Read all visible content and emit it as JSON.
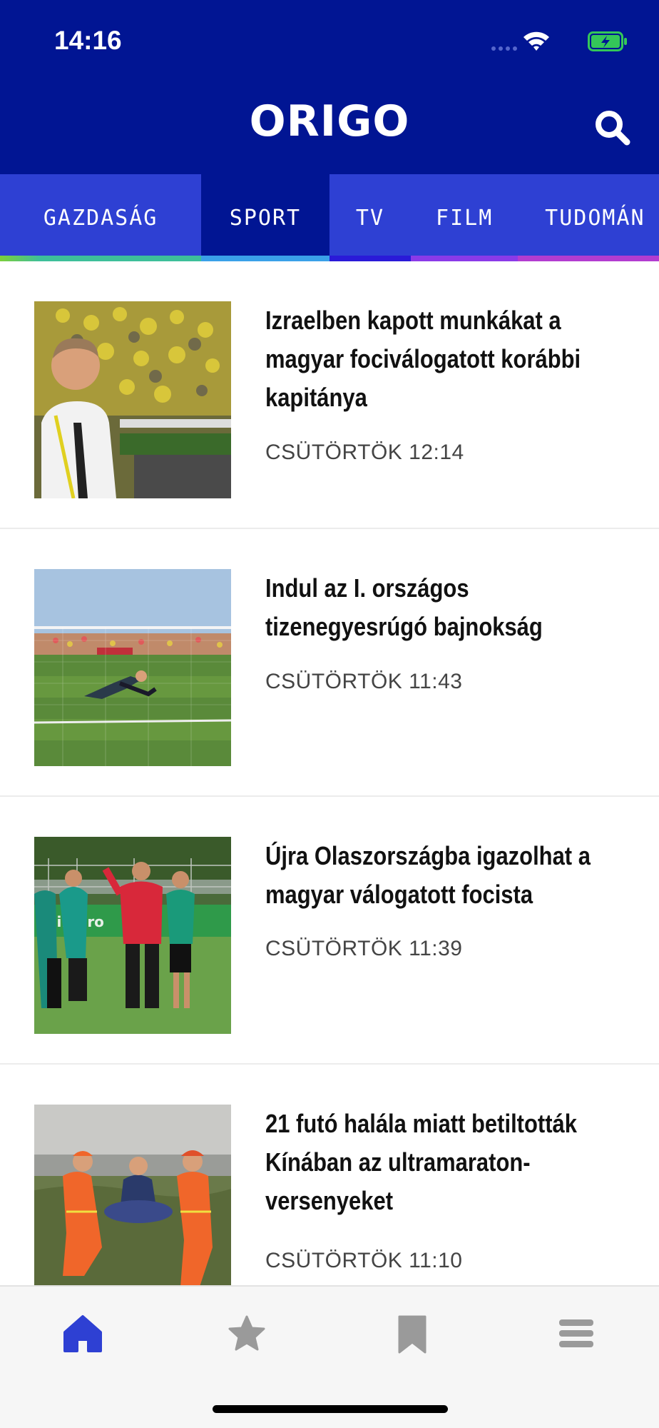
{
  "status_bar": {
    "time": "14:16"
  },
  "header": {
    "logo": "ORIGO"
  },
  "tabs": [
    {
      "label": "GAZDASÁG",
      "color": "#3dbf9a"
    },
    {
      "label": "SPORT",
      "color": "#3aa0e8",
      "active": true
    },
    {
      "label": "TV",
      "color": "#2a1ad8"
    },
    {
      "label": "FILM",
      "color": "#8a3ae8"
    },
    {
      "label": "TUDOMÁN",
      "color": "#b33cd0"
    }
  ],
  "articles": [
    {
      "title_lines": [
        "Izraelben kapott munkákat a",
        "magyar fociválogatott korábbi",
        "kapitánya"
      ],
      "time": "CSÜTÖRTÖK 12:14"
    },
    {
      "title_lines": [
        "Indul az I. országos",
        "tizenegyesrúgó bajnokság"
      ],
      "time": "CSÜTÖRTÖK 11:43"
    },
    {
      "title_lines": [
        "Újra Olaszországba igazolhat a",
        "magyar válogatott focista"
      ],
      "time": "CSÜTÖRTÖK 11:39",
      "banner_text": "zsik-pro"
    },
    {
      "title_lines": [
        "21 futó halála miatt betiltották",
        "Kínában az ultramaraton-",
        "versenyeket"
      ],
      "time": "CSÜTÖRTÖK 11:10"
    }
  ],
  "bottom_nav": [
    {
      "icon": "home-icon",
      "active": true
    },
    {
      "icon": "star-icon"
    },
    {
      "icon": "bookmark-icon"
    },
    {
      "icon": "menu-icon"
    }
  ],
  "colors": {
    "header_bg": "#011593",
    "tab_bg": "#2e40d3",
    "nav_active": "#2e40d3",
    "nav_inactive": "#9a9a9a"
  }
}
